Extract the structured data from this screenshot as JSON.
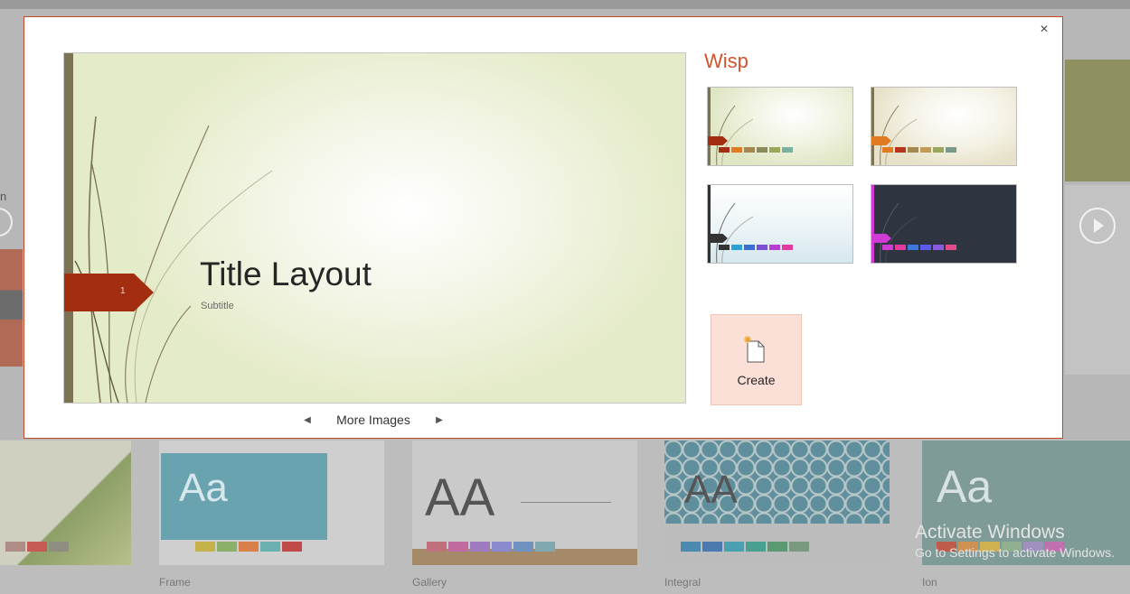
{
  "dialog": {
    "theme_name": "Wisp",
    "close_glyph": "×",
    "preview": {
      "title": "Title Layout",
      "subtitle": "Subtitle",
      "slide_number": "1"
    },
    "more_images": {
      "label": "More Images",
      "prev_glyph": "◀",
      "next_glyph": "▶"
    },
    "variants": [
      {
        "accent": "#a32e0f",
        "swatches": [
          "#a32e0f",
          "#e07b22",
          "#a5884f",
          "#8a8a5a",
          "#9aa65a",
          "#7ab0a0"
        ]
      },
      {
        "accent": "#e07b22",
        "swatches": [
          "#e07b22",
          "#b7331e",
          "#a5884f",
          "#c29a55",
          "#9aa65a",
          "#7a9a8a"
        ]
      },
      {
        "accent": "#333333",
        "swatches": [
          "#333333",
          "#29a3d6",
          "#3a6fd0",
          "#7a4fd1",
          "#b83dd1",
          "#e23aa1"
        ]
      },
      {
        "accent": "#d23ad6",
        "swatches": [
          "#d23ad6",
          "#e23a9c",
          "#3a7ae0",
          "#5a5af0",
          "#8a5ae0",
          "#e24a8a"
        ]
      }
    ],
    "create": {
      "label": "Create",
      "icon": "new-document-icon"
    }
  },
  "background": {
    "partial_label": "n",
    "thumbnails": [
      {
        "name": "",
        "aa": ""
      },
      {
        "name": "Frame",
        "aa": "Aa"
      },
      {
        "name": "Gallery",
        "aa": "AA"
      },
      {
        "name": "Integral",
        "aa": "AA"
      },
      {
        "name": "Ion",
        "aa": "Aa"
      }
    ],
    "watermark": {
      "line1": "Activate Windows",
      "line2": "Go to Settings to activate Windows."
    }
  }
}
